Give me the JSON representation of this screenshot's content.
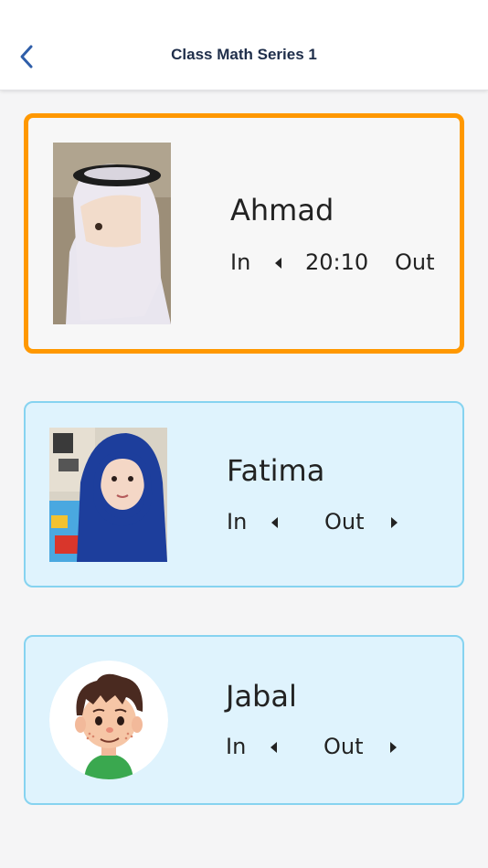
{
  "header": {
    "title": "Class Math Series 1",
    "back_icon": "chevron-left-icon"
  },
  "colors": {
    "accent_selected": "#ff9800",
    "card_border": "#86d3f0",
    "card_bg": "#dff3fd",
    "back_icon": "#2f5ea9"
  },
  "students": [
    {
      "name": "Ahmad",
      "in_label": "In",
      "time": "20:10",
      "out_label": "Out",
      "selected": true
    },
    {
      "name": "Fatima",
      "in_label": "In",
      "out_label": "Out",
      "selected": false
    },
    {
      "name": "Jabal",
      "in_label": "In",
      "out_label": "Out",
      "selected": false
    }
  ]
}
